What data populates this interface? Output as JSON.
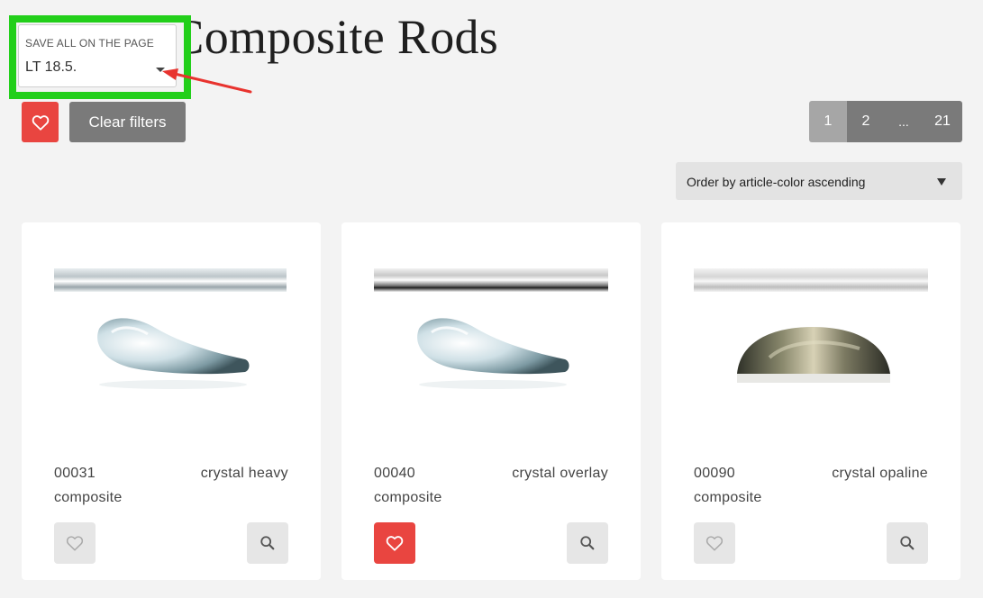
{
  "page": {
    "title_visible": "ing and Composite Rods"
  },
  "save_popup": {
    "label": "SAVE ALL ON THE PAGE",
    "value": "LT 18.5."
  },
  "filters": {
    "favorites_icon": "heart-icon",
    "clear_label": "Clear filters"
  },
  "pagination": {
    "pages": [
      "1",
      "2",
      "...",
      "21"
    ],
    "current": "1"
  },
  "order": {
    "selected": "Order by article-color ascending"
  },
  "colors": {
    "accent_red": "#e94540",
    "highlight_green": "#22cf1a",
    "button_gray": "#7a7a7a"
  },
  "products": [
    {
      "code": "00031",
      "description": "crystal heavy",
      "type": "composite",
      "favorite": false,
      "image": "clear-drop-rod"
    },
    {
      "code": "00040",
      "description": "crystal overlay",
      "type": "composite",
      "favorite": true,
      "image": "clear-drop-rod"
    },
    {
      "code": "00090",
      "description": "crystal opaline",
      "type": "composite",
      "favorite": false,
      "image": "opaline-dome-rod"
    }
  ]
}
